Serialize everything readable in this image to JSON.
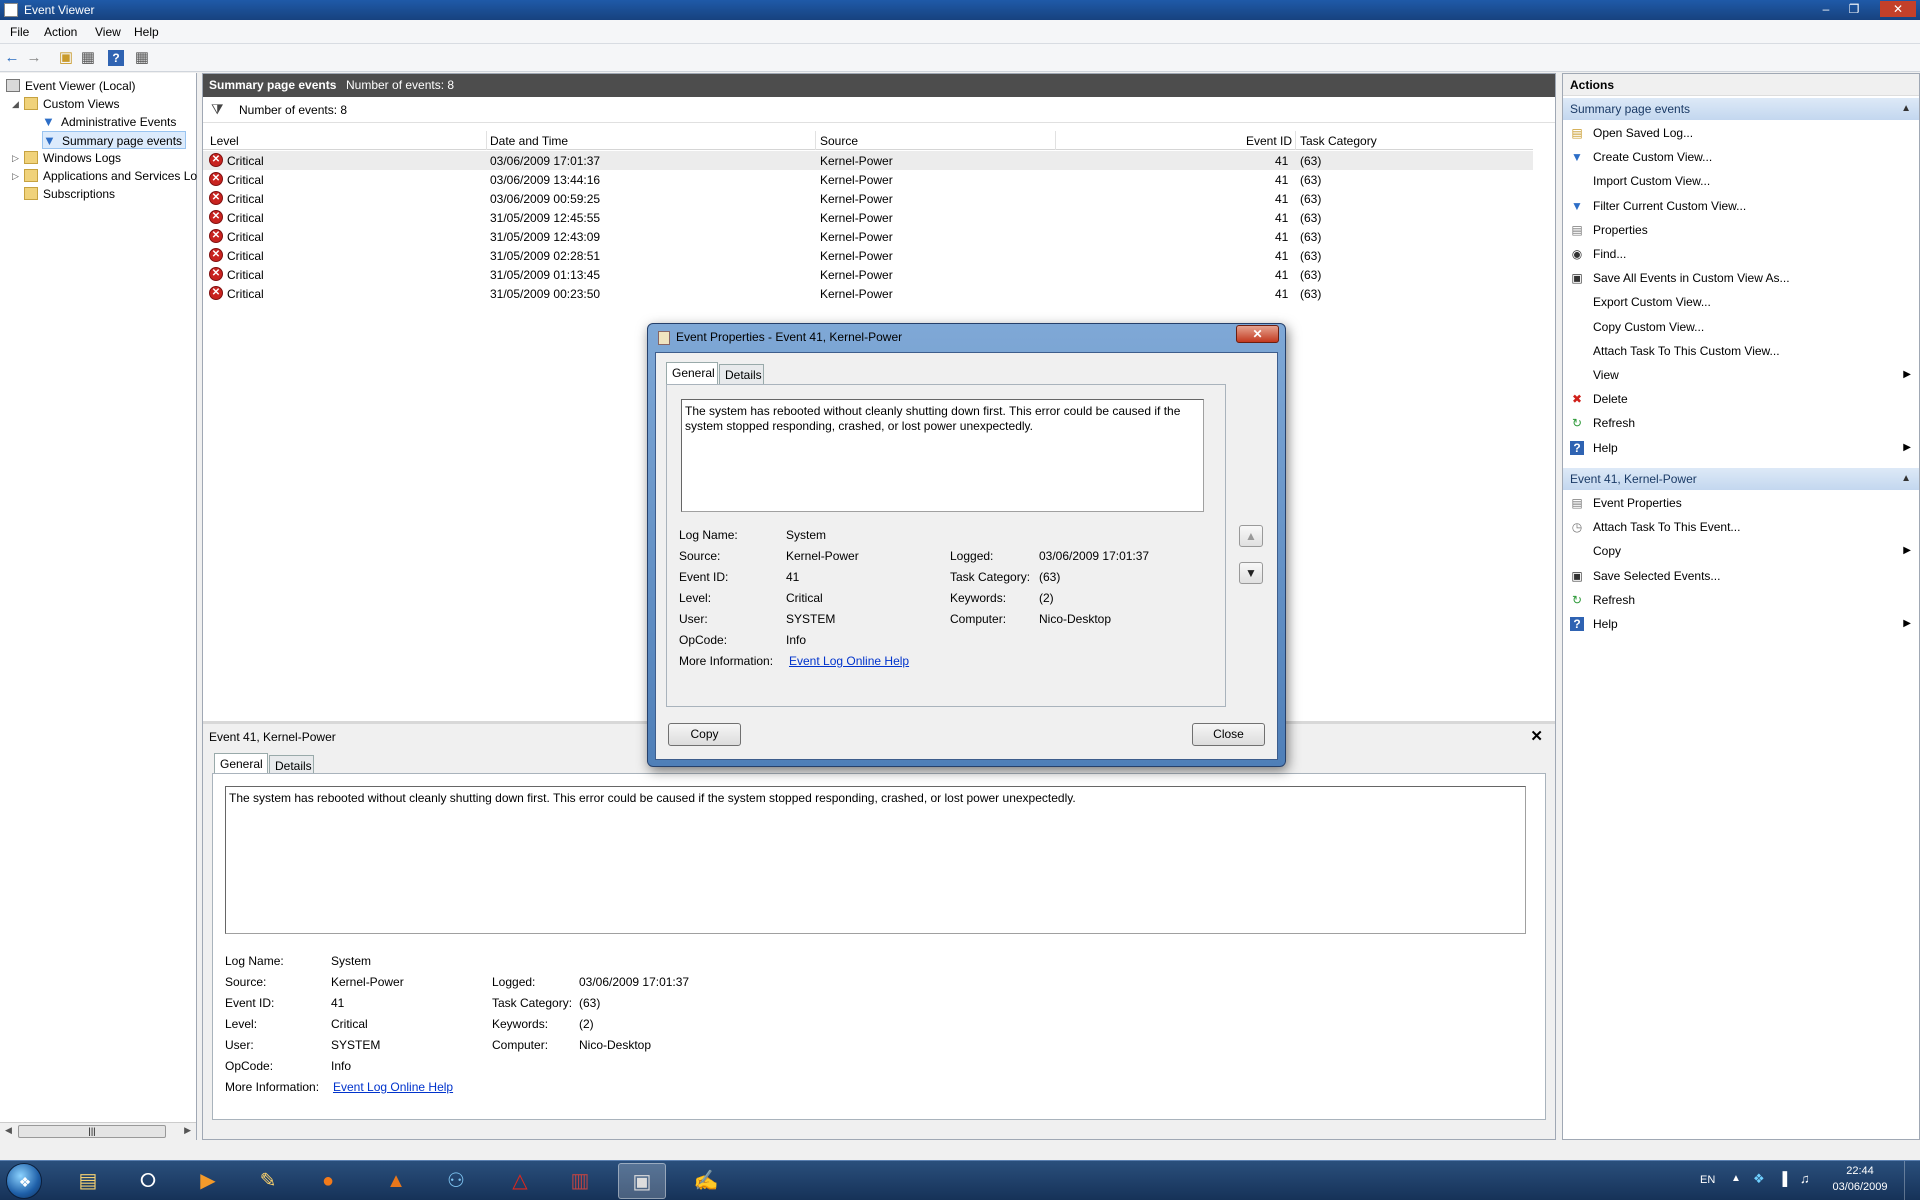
{
  "window": {
    "title": "Event Viewer",
    "minimize_label": "–",
    "restore_label": "❐",
    "close_label": "✕"
  },
  "menu": [
    "File",
    "Action",
    "View",
    "Help"
  ],
  "tree": {
    "root": "Event Viewer (Local)",
    "custom_views": "Custom Views",
    "admin_events": "Administrative Events",
    "summary_events": "Summary page events",
    "windows_logs": "Windows Logs",
    "apps_services": "Applications and Services Lo",
    "subscriptions": "Subscriptions"
  },
  "center": {
    "header_title": "Summary page events",
    "header_count": "Number of events: 8",
    "filter_count": "Number of events: 8",
    "columns": [
      "Level",
      "Date and Time",
      "Source",
      "Event ID",
      "Task Category"
    ],
    "rows": [
      {
        "level": "Critical",
        "datetime": "03/06/2009 17:01:37",
        "source": "Kernel-Power",
        "event_id": "41",
        "task": "(63)"
      },
      {
        "level": "Critical",
        "datetime": "03/06/2009 13:44:16",
        "source": "Kernel-Power",
        "event_id": "41",
        "task": "(63)"
      },
      {
        "level": "Critical",
        "datetime": "03/06/2009 00:59:25",
        "source": "Kernel-Power",
        "event_id": "41",
        "task": "(63)"
      },
      {
        "level": "Critical",
        "datetime": "31/05/2009 12:45:55",
        "source": "Kernel-Power",
        "event_id": "41",
        "task": "(63)"
      },
      {
        "level": "Critical",
        "datetime": "31/05/2009 12:43:09",
        "source": "Kernel-Power",
        "event_id": "41",
        "task": "(63)"
      },
      {
        "level": "Critical",
        "datetime": "31/05/2009 02:28:51",
        "source": "Kernel-Power",
        "event_id": "41",
        "task": "(63)"
      },
      {
        "level": "Critical",
        "datetime": "31/05/2009 01:13:45",
        "source": "Kernel-Power",
        "event_id": "41",
        "task": "(63)"
      },
      {
        "level": "Critical",
        "datetime": "31/05/2009 00:23:50",
        "source": "Kernel-Power",
        "event_id": "41",
        "task": "(63)"
      }
    ]
  },
  "event": {
    "title": "Event 41, Kernel-Power",
    "tab_general": "General",
    "tab_details": "Details",
    "message": "The system has rebooted without cleanly shutting down first. This error could be caused if the system stopped responding, crashed, or lost power unexpectedly.",
    "labels": {
      "log_name": "Log Name:",
      "source": "Source:",
      "event_id": "Event ID:",
      "level": "Level:",
      "user": "User:",
      "opcode": "OpCode:",
      "more_info": "More Information:",
      "logged": "Logged:",
      "task_category": "Task Category:",
      "keywords": "Keywords:",
      "computer": "Computer:"
    },
    "values": {
      "log_name": "System",
      "source": "Kernel-Power",
      "event_id": "41",
      "level": "Critical",
      "user": "SYSTEM",
      "opcode": "Info",
      "more_info_link": "Event Log Online Help",
      "logged": "03/06/2009 17:01:37",
      "task_category": "(63)",
      "keywords": "(2)",
      "computer": "Nico-Desktop"
    }
  },
  "dialog": {
    "title": "Event Properties - Event 41, Kernel-Power",
    "close_x": "✕",
    "copy_button": "Copy",
    "close_button": "Close"
  },
  "actions": {
    "title": "Actions",
    "section1": "Summary page events",
    "items1": [
      {
        "label": "Open Saved Log...",
        "icon": "open-log-icon"
      },
      {
        "label": "Create Custom View...",
        "icon": "filter-icon"
      },
      {
        "label": "Import Custom View...",
        "icon": ""
      },
      {
        "label": "Filter Current Custom View...",
        "icon": "filter-icon"
      },
      {
        "label": "Properties",
        "icon": "properties-icon"
      },
      {
        "label": "Find...",
        "icon": "binoculars-icon"
      },
      {
        "label": "Save All Events in Custom View As...",
        "icon": "save-icon"
      },
      {
        "label": "Export Custom View...",
        "icon": ""
      },
      {
        "label": "Copy Custom View...",
        "icon": ""
      },
      {
        "label": "Attach Task To This Custom View...",
        "icon": ""
      },
      {
        "label": "View",
        "icon": "",
        "submenu": true
      },
      {
        "label": "Delete",
        "icon": "delete-icon"
      },
      {
        "label": "Refresh",
        "icon": "refresh-icon"
      },
      {
        "label": "Help",
        "icon": "help-icon",
        "submenu": true
      }
    ],
    "section2": "Event 41, Kernel-Power",
    "items2": [
      {
        "label": "Event Properties",
        "icon": "properties-icon"
      },
      {
        "label": "Attach Task To This Event...",
        "icon": "task-icon"
      },
      {
        "label": "Copy",
        "icon": "copy-icon",
        "submenu": true
      },
      {
        "label": "Save Selected Events...",
        "icon": "save-icon"
      },
      {
        "label": "Refresh",
        "icon": "refresh-icon"
      },
      {
        "label": "Help",
        "icon": "help-icon",
        "submenu": true
      }
    ]
  },
  "taskbar": {
    "language": "EN",
    "time": "22:44",
    "date": "03/06/2009"
  }
}
